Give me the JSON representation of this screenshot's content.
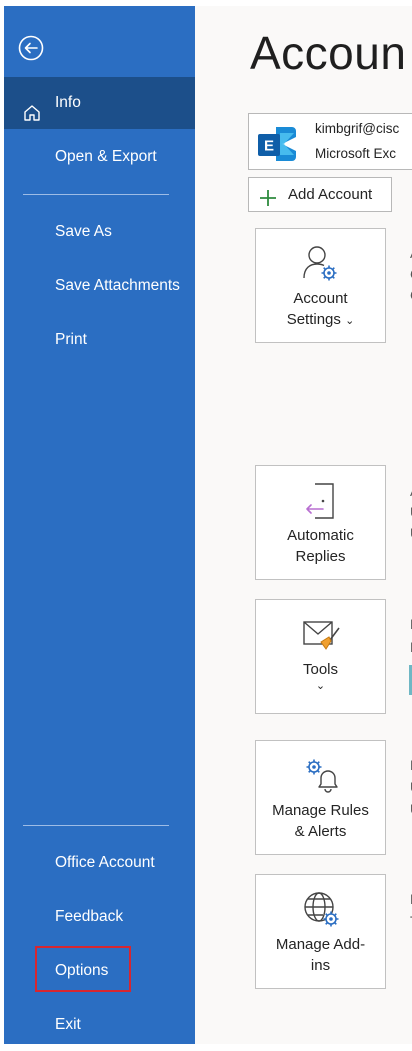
{
  "sidebar": {
    "items": [
      {
        "label": "Info"
      },
      {
        "label": "Open & Export"
      },
      {
        "label": "Save As"
      },
      {
        "label": "Save Attachments"
      },
      {
        "label": "Print"
      },
      {
        "label": "Office Account"
      },
      {
        "label": "Feedback"
      },
      {
        "label": "Options"
      },
      {
        "label": "Exit"
      }
    ],
    "selected": "Info",
    "highlighted": "Options",
    "highlight_color": "#d8262f"
  },
  "main": {
    "title": "Accoun",
    "account": {
      "email": "kimbgrif@cisc",
      "type": "Microsoft Exc"
    },
    "add_account_label": "Add Account",
    "tiles": [
      {
        "line1": "Account",
        "line2": "Settings",
        "chevron": "⌄",
        "icon": "account-settings-icon"
      },
      {
        "line1": "Automatic",
        "line2": "Replies",
        "icon": "automatic-replies-icon"
      },
      {
        "line1": "Tools",
        "chevron": "⌄",
        "icon": "tools-icon"
      },
      {
        "line1": "Manage Rules",
        "line2": "& Alerts",
        "icon": "manage-rules-icon"
      },
      {
        "line1": "Manage Add-",
        "line2": "ins",
        "icon": "manage-addins-icon"
      }
    ],
    "side_fragments": [
      "A",
      "C",
      "C",
      "A",
      "U",
      "U",
      "F",
      "F",
      "F",
      "U",
      "U",
      "F",
      "T"
    ]
  },
  "colors": {
    "sidebar_bg": "#2b6ec2",
    "sidebar_selected": "#1c4f8a",
    "accent_purple": "#b86fd1",
    "accent_blue": "#2b6ec2"
  }
}
